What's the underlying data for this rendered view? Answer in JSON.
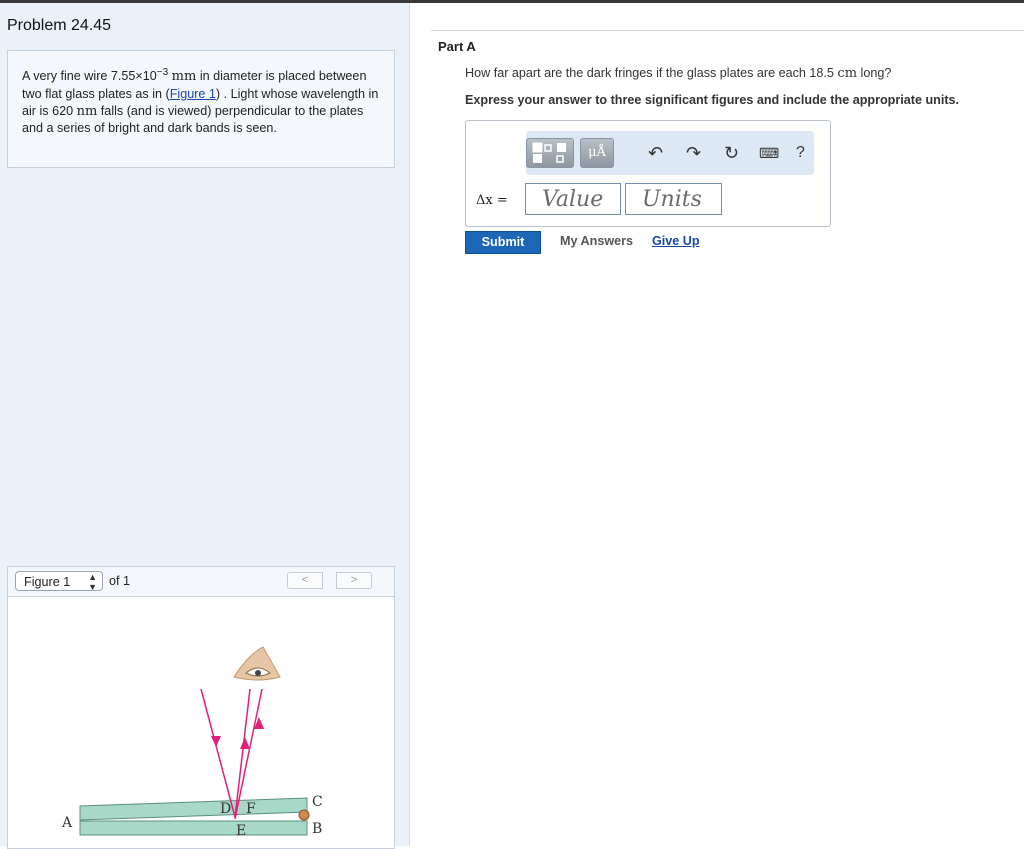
{
  "problem": {
    "title": "Problem 24.45",
    "text_part1": "A very fine wire 7.55×10",
    "exponent": "−3",
    "unit_mm": "mm",
    "text_part2": " in diameter is placed between two flat glass plates as in (",
    "figure_link": "Figure 1",
    "text_part3": ") . Light whose wavelength in air is 620 ",
    "unit_nm": "nm",
    "text_part4": " falls (and is viewed) perpendicular to the plates and a series of bright and dark bands is seen."
  },
  "figure": {
    "select_label": "Figure 1",
    "of_label": "of 1",
    "prev_icon": "chevron-left-icon",
    "next_icon": "chevron-right-icon",
    "labels": {
      "A": "A",
      "B": "B",
      "C": "C",
      "D": "D",
      "E": "E",
      "F": "F"
    },
    "colors": {
      "glass": "#a8d8c8",
      "ray": "#e0207a",
      "wire": "#d0894a"
    }
  },
  "part": {
    "label": "Part A",
    "question_prefix": "How far apart are the dark fringes if the glass plates are each 18.5 ",
    "question_unit": "cm",
    "question_suffix": " long?",
    "instruction": "Express your answer to three significant figures and include the appropriate units."
  },
  "answer": {
    "variable_label": "Δx =",
    "value_placeholder": "Value",
    "units_placeholder": "Units",
    "toolbar": {
      "templates_icon": "templates-icon",
      "units_button_label": "μÅ",
      "undo_icon": "undo-icon",
      "redo_icon": "redo-icon",
      "reset_icon": "reset-icon",
      "keyboard_icon": "keyboard-icon",
      "help_label": "?"
    }
  },
  "actions": {
    "submit": "Submit",
    "my_answers": "My Answers",
    "give_up": "Give Up"
  },
  "colors": {
    "accent": "#1c66b8",
    "link": "#1a47a8"
  }
}
